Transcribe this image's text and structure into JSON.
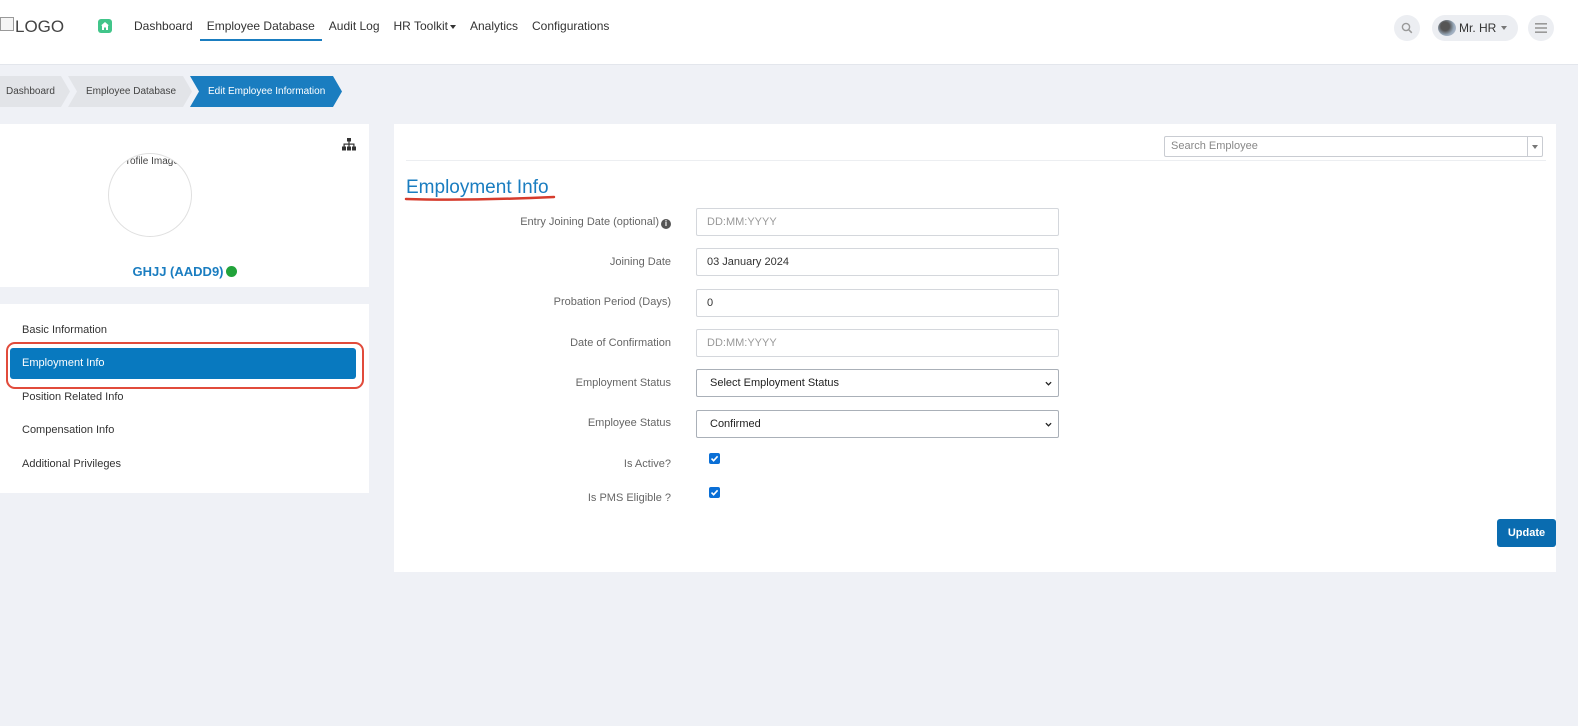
{
  "header": {
    "logo_text": "LOGO",
    "nav": [
      {
        "label": "Dashboard"
      },
      {
        "label": "Employee Database"
      },
      {
        "label": "Audit Log"
      },
      {
        "label": "HR Toolkit"
      },
      {
        "label": "Analytics"
      },
      {
        "label": "Configurations"
      }
    ],
    "user_name": "Mr. HR"
  },
  "breadcrumb": [
    "Dashboard",
    "Employee Database",
    "Edit Employee Information"
  ],
  "profile": {
    "image_alt": "Profile Image",
    "name": "GHJJ (AADD9)",
    "status_color": "#21a33a"
  },
  "sidebar_menu": [
    {
      "label": "Basic Information"
    },
    {
      "label": "Employment Info",
      "active": true
    },
    {
      "label": "Position Related Info"
    },
    {
      "label": "Compensation Info"
    },
    {
      "label": "Additional Privileges"
    }
  ],
  "search_employee_placeholder": "Search Employee",
  "section_title": "Employment Info",
  "form": {
    "entry_joining_date": {
      "label": "Entry Joining Date (optional)",
      "placeholder": "DD:MM:YYYY",
      "value": ""
    },
    "joining_date": {
      "label": "Joining Date",
      "value": "03 January 2024"
    },
    "probation_period": {
      "label": "Probation Period (Days)",
      "value": "0"
    },
    "date_of_confirmation": {
      "label": "Date of Confirmation",
      "placeholder": "DD:MM:YYYY",
      "value": ""
    },
    "employment_status": {
      "label": "Employment Status",
      "selected": "Select Employment Status"
    },
    "employee_status": {
      "label": "Employee Status",
      "selected": "Confirmed"
    },
    "is_active": {
      "label": "Is Active?",
      "checked": true
    },
    "is_pms_eligible": {
      "label": "Is PMS Eligible ?",
      "checked": true
    }
  },
  "update_button": "Update",
  "colors": {
    "accent": "#1a7dc0",
    "highlight": "#e14b3b",
    "background": "#eff1f6"
  }
}
